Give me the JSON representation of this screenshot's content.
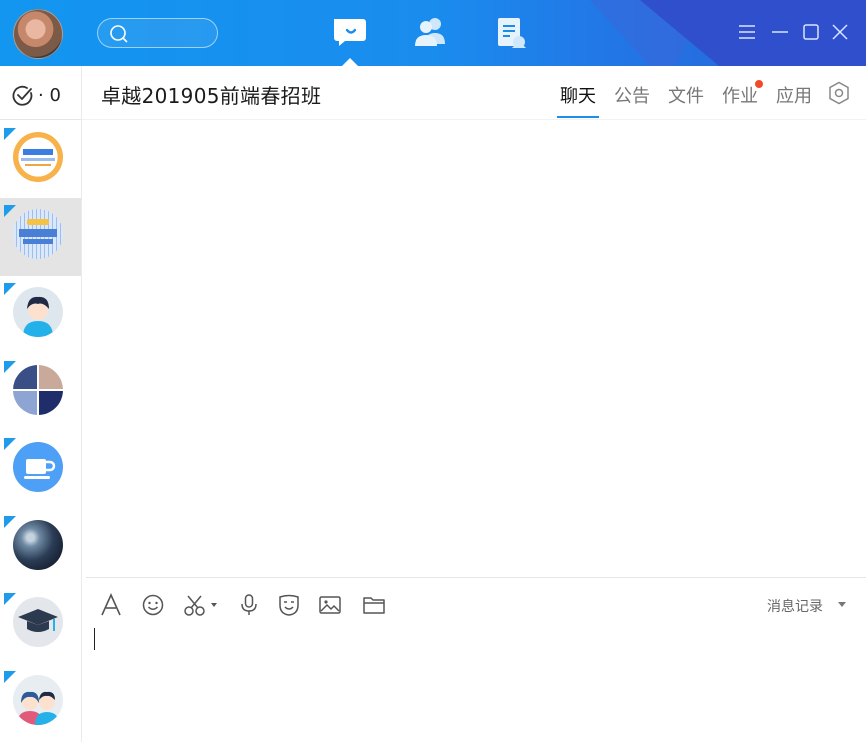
{
  "titlebar": {
    "avatar": "user-avatar",
    "search_placeholder": "",
    "nav": [
      {
        "name": "chat-nav",
        "icon": "chat-bubble-icon",
        "active": true
      },
      {
        "name": "contacts-nav",
        "icon": "contacts-icon",
        "active": false
      },
      {
        "name": "docs-nav",
        "icon": "document-icon",
        "active": false
      }
    ],
    "window_controls": [
      "menu-icon",
      "minimize-icon",
      "maximize-icon",
      "close-icon"
    ]
  },
  "sidebar": {
    "todo_count": "· 0",
    "conversations": [
      {
        "name": "conversation-zhuoyue-group",
        "active": false,
        "avatar_colors": [
          "#f7b24a",
          "#ffffff"
        ]
      },
      {
        "name": "conversation-201905-class",
        "active": true,
        "avatar_colors": [
          "#7fa7e8",
          "#dbe7fb"
        ]
      },
      {
        "name": "conversation-boy-avatar",
        "active": false,
        "avatar_colors": [
          "#dfe7ee",
          "#24b0e9"
        ]
      },
      {
        "name": "conversation-photo-grid",
        "active": false,
        "avatar_colors": [
          "#2b3e73",
          "#c9cbd8"
        ]
      },
      {
        "name": "conversation-cup",
        "active": false,
        "avatar_colors": [
          "#4ea0f6",
          "#ffffff"
        ]
      },
      {
        "name": "conversation-night-sky",
        "active": false,
        "avatar_colors": [
          "#1c2a3e",
          "#9db2c8"
        ]
      },
      {
        "name": "conversation-graduation",
        "active": false,
        "avatar_colors": [
          "#e3e7ec",
          "#2c3a4f"
        ]
      },
      {
        "name": "conversation-couple",
        "active": false,
        "avatar_colors": [
          "#e8edf2",
          "#2d5a98"
        ]
      }
    ]
  },
  "chat": {
    "title": "卓越201905前端春招班",
    "tabs": [
      "聊天",
      "公告",
      "文件",
      "作业",
      "应用"
    ],
    "active_tab": "聊天",
    "homework_has_notification": true
  },
  "composer": {
    "tools": [
      "font-icon",
      "emoji-icon",
      "screenshot-icon",
      "voice-icon",
      "sticker-icon",
      "image-icon",
      "folder-icon"
    ],
    "history_label": "消息记录",
    "input_value": ""
  },
  "colors": {
    "accent": "#1e8fe8",
    "badge": "#f04a2b",
    "titlebar": "#1a8cee"
  }
}
